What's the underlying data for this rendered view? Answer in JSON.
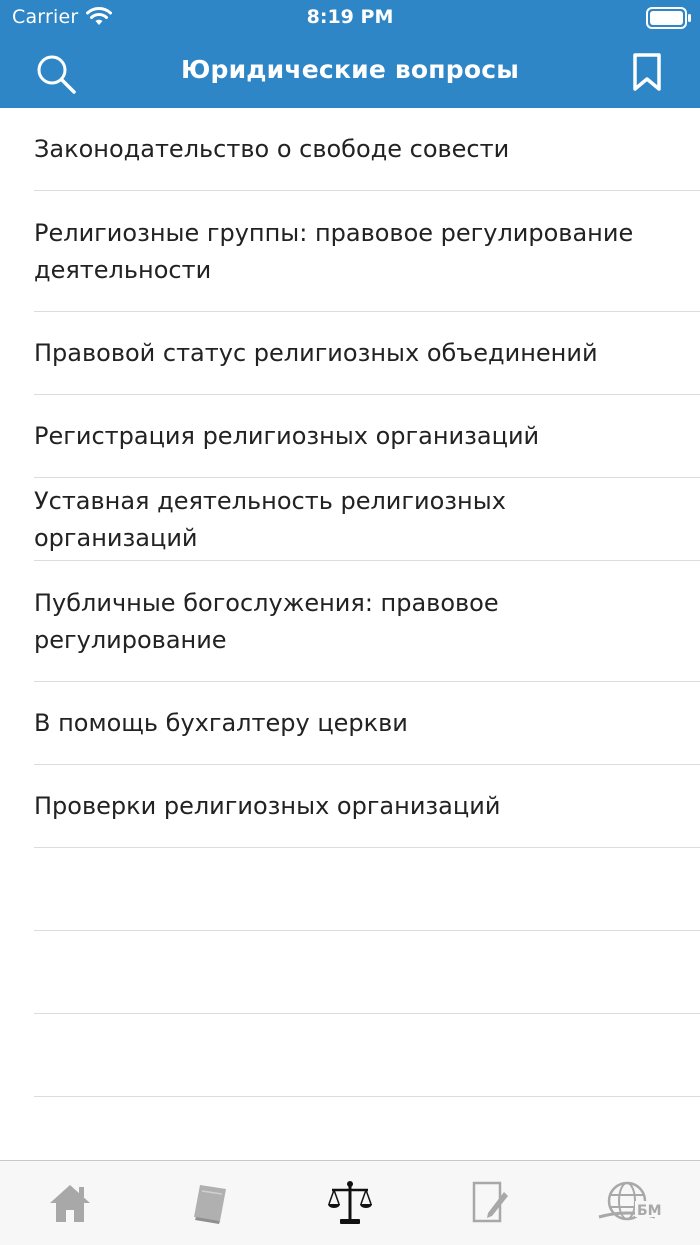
{
  "status_bar": {
    "carrier": "Carrier",
    "time": "8:19 PM"
  },
  "nav": {
    "title": "Юридические вопросы",
    "left_icon": "search-icon",
    "right_icon": "bookmark-icon"
  },
  "list": {
    "items": [
      {
        "label": "Законодательство о свободе совести"
      },
      {
        "label": "Религиозные группы: правовое регулирование деятельности"
      },
      {
        "label": "Правовой статус религиозных объединений"
      },
      {
        "label": "Регистрация религиозных организаций"
      },
      {
        "label": "Уставная деятельность религиозных организаций"
      },
      {
        "label": "Публичные богослужения: правовое регулирование"
      },
      {
        "label": "В помощь бухгалтеру церкви"
      },
      {
        "label": "Проверки религиозных организаций"
      }
    ]
  },
  "tabbar": {
    "tabs": [
      {
        "icon": "home-icon",
        "active": false
      },
      {
        "icon": "book-icon",
        "active": false
      },
      {
        "icon": "scales-icon",
        "active": true
      },
      {
        "icon": "note-pencil-icon",
        "active": false
      },
      {
        "icon": "globe-logo-icon",
        "active": false
      }
    ],
    "logo_text": "БМ"
  },
  "colors": {
    "accent": "#2f86c6",
    "text": "#222222",
    "separator": "#dcdcdc",
    "tab_inactive": "#a8a8a8",
    "tab_active": "#111111"
  }
}
